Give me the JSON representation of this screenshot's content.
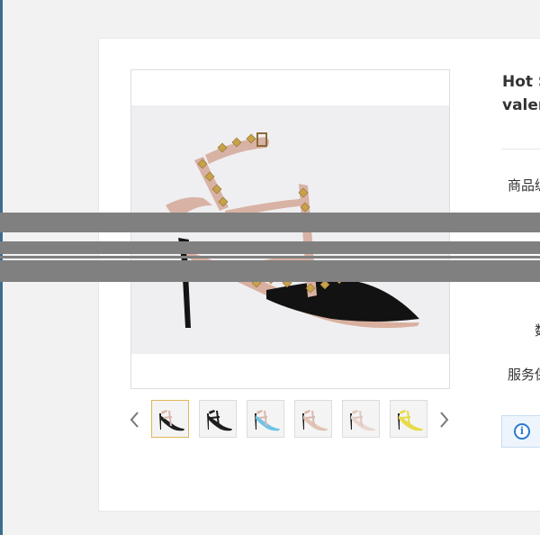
{
  "product": {
    "title_line1": "Hot S",
    "title_line2": "valer",
    "main_image_icon": "shoe-main-image",
    "attributes": [
      {
        "label": "商品编"
      },
      {
        "label": "数"
      },
      {
        "label": "服务保"
      }
    ]
  },
  "gallery": {
    "prev_icon": "chevron-left-icon",
    "next_icon": "chevron-right-icon",
    "thumbnails": [
      {
        "name": "black",
        "upper": "#1e1e1e",
        "strap": "#d9b8ac",
        "selected": true
      },
      {
        "name": "black-2",
        "upper": "#1e1e1e",
        "strap": "#1e1e1e",
        "selected": false
      },
      {
        "name": "blue",
        "upper": "#6fc4e6",
        "strap": "#d9b8ac",
        "selected": false
      },
      {
        "name": "nude",
        "upper": "#e2c3b4",
        "strap": "#d9b8ac",
        "selected": false
      },
      {
        "name": "rose",
        "upper": "#e8d7d0",
        "strap": "#e0c6bd",
        "selected": false
      },
      {
        "name": "yellow",
        "upper": "#e6db4a",
        "strap": "#e6db4a",
        "selected": false
      }
    ]
  },
  "notice": {
    "icon": "info-icon",
    "glyph": "i"
  },
  "colors": {
    "accent_selected": "#e0b65a",
    "info_blue": "#2a7ad2",
    "mask_gray": "#808080"
  }
}
